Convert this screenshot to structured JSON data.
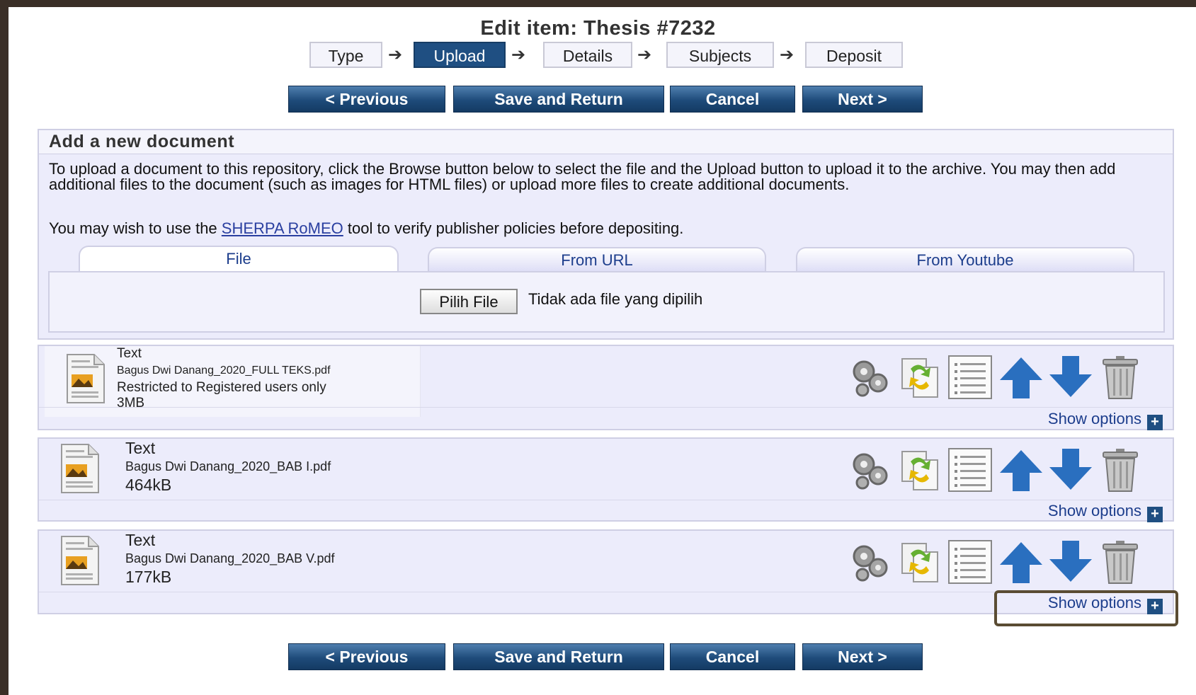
{
  "page": {
    "title": "Edit item: Thesis #7232"
  },
  "steps": [
    {
      "label": "Type",
      "active": false
    },
    {
      "label": "Upload",
      "active": true
    },
    {
      "label": "Details",
      "active": false
    },
    {
      "label": "Subjects",
      "active": false
    },
    {
      "label": "Deposit",
      "active": false
    }
  ],
  "step_arrow": "➔",
  "buttons": {
    "previous": "< Previous",
    "save_return": "Save and Return",
    "cancel": "Cancel",
    "next": "Next >"
  },
  "add_document": {
    "heading": "Add a new document",
    "intro": "To upload a document to this repository, click the Browse button below to select the file and the Upload button to upload it to the archive. You may then add additional files to the document (such as images for HTML files) or upload more files to create additional documents.",
    "romeo_prefix": "You may wish to use the",
    "romeo_link": "SHERPA RoMEO",
    "romeo_suffix": "tool to verify publisher policies before depositing.",
    "tabs": [
      "File",
      "From URL",
      "From Youtube"
    ],
    "file_button": "Pilih File",
    "file_status": "Tidak ada file yang dipilih"
  },
  "documents": [
    {
      "type": "Text",
      "filename": "Bagus Dwi Danang_2020_FULL TEKS.pdf",
      "restriction": "Restricted to Registered users only",
      "size": "3MB",
      "show_options": "Show options"
    },
    {
      "type": "Text",
      "filename": "Bagus Dwi Danang_2020_BAB I.pdf",
      "size": "464kB",
      "show_options": "Show options"
    },
    {
      "type": "Text",
      "filename": "Bagus Dwi Danang_2020_BAB V.pdf",
      "size": "177kB",
      "show_options": "Show options"
    }
  ],
  "doc_action_icons": [
    "gears-icon",
    "convert-icon",
    "list-icon",
    "arrow-up-icon",
    "arrow-down-icon",
    "trash-icon"
  ],
  "colors": {
    "button_blue": "#1e4b7a",
    "panel_bg": "#ececfb",
    "link_blue": "#1c3d8c",
    "highlight_border": "#5a4c33"
  }
}
